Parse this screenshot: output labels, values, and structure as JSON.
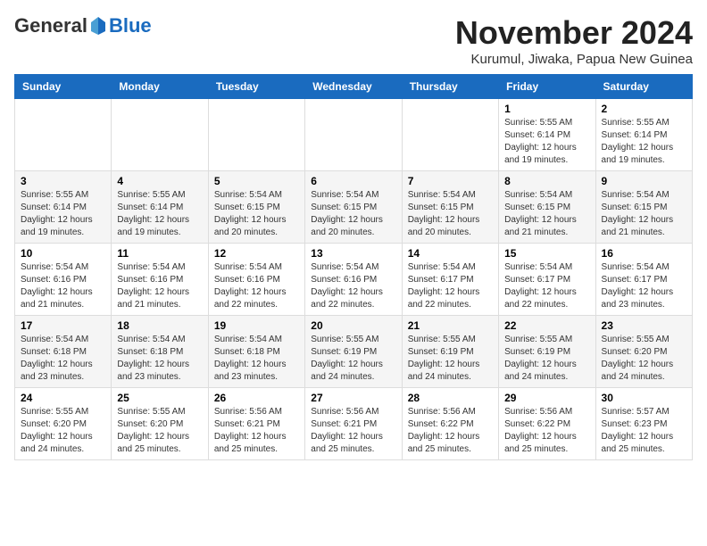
{
  "logo": {
    "general": "General",
    "blue": "Blue"
  },
  "title": "November 2024",
  "location": "Kurumul, Jiwaka, Papua New Guinea",
  "days_of_week": [
    "Sunday",
    "Monday",
    "Tuesday",
    "Wednesday",
    "Thursday",
    "Friday",
    "Saturday"
  ],
  "weeks": [
    [
      {
        "day": "",
        "info": ""
      },
      {
        "day": "",
        "info": ""
      },
      {
        "day": "",
        "info": ""
      },
      {
        "day": "",
        "info": ""
      },
      {
        "day": "",
        "info": ""
      },
      {
        "day": "1",
        "info": "Sunrise: 5:55 AM\nSunset: 6:14 PM\nDaylight: 12 hours\nand 19 minutes."
      },
      {
        "day": "2",
        "info": "Sunrise: 5:55 AM\nSunset: 6:14 PM\nDaylight: 12 hours\nand 19 minutes."
      }
    ],
    [
      {
        "day": "3",
        "info": "Sunrise: 5:55 AM\nSunset: 6:14 PM\nDaylight: 12 hours\nand 19 minutes."
      },
      {
        "day": "4",
        "info": "Sunrise: 5:55 AM\nSunset: 6:14 PM\nDaylight: 12 hours\nand 19 minutes."
      },
      {
        "day": "5",
        "info": "Sunrise: 5:54 AM\nSunset: 6:15 PM\nDaylight: 12 hours\nand 20 minutes."
      },
      {
        "day": "6",
        "info": "Sunrise: 5:54 AM\nSunset: 6:15 PM\nDaylight: 12 hours\nand 20 minutes."
      },
      {
        "day": "7",
        "info": "Sunrise: 5:54 AM\nSunset: 6:15 PM\nDaylight: 12 hours\nand 20 minutes."
      },
      {
        "day": "8",
        "info": "Sunrise: 5:54 AM\nSunset: 6:15 PM\nDaylight: 12 hours\nand 21 minutes."
      },
      {
        "day": "9",
        "info": "Sunrise: 5:54 AM\nSunset: 6:15 PM\nDaylight: 12 hours\nand 21 minutes."
      }
    ],
    [
      {
        "day": "10",
        "info": "Sunrise: 5:54 AM\nSunset: 6:16 PM\nDaylight: 12 hours\nand 21 minutes."
      },
      {
        "day": "11",
        "info": "Sunrise: 5:54 AM\nSunset: 6:16 PM\nDaylight: 12 hours\nand 21 minutes."
      },
      {
        "day": "12",
        "info": "Sunrise: 5:54 AM\nSunset: 6:16 PM\nDaylight: 12 hours\nand 22 minutes."
      },
      {
        "day": "13",
        "info": "Sunrise: 5:54 AM\nSunset: 6:16 PM\nDaylight: 12 hours\nand 22 minutes."
      },
      {
        "day": "14",
        "info": "Sunrise: 5:54 AM\nSunset: 6:17 PM\nDaylight: 12 hours\nand 22 minutes."
      },
      {
        "day": "15",
        "info": "Sunrise: 5:54 AM\nSunset: 6:17 PM\nDaylight: 12 hours\nand 22 minutes."
      },
      {
        "day": "16",
        "info": "Sunrise: 5:54 AM\nSunset: 6:17 PM\nDaylight: 12 hours\nand 23 minutes."
      }
    ],
    [
      {
        "day": "17",
        "info": "Sunrise: 5:54 AM\nSunset: 6:18 PM\nDaylight: 12 hours\nand 23 minutes."
      },
      {
        "day": "18",
        "info": "Sunrise: 5:54 AM\nSunset: 6:18 PM\nDaylight: 12 hours\nand 23 minutes."
      },
      {
        "day": "19",
        "info": "Sunrise: 5:54 AM\nSunset: 6:18 PM\nDaylight: 12 hours\nand 23 minutes."
      },
      {
        "day": "20",
        "info": "Sunrise: 5:55 AM\nSunset: 6:19 PM\nDaylight: 12 hours\nand 24 minutes."
      },
      {
        "day": "21",
        "info": "Sunrise: 5:55 AM\nSunset: 6:19 PM\nDaylight: 12 hours\nand 24 minutes."
      },
      {
        "day": "22",
        "info": "Sunrise: 5:55 AM\nSunset: 6:19 PM\nDaylight: 12 hours\nand 24 minutes."
      },
      {
        "day": "23",
        "info": "Sunrise: 5:55 AM\nSunset: 6:20 PM\nDaylight: 12 hours\nand 24 minutes."
      }
    ],
    [
      {
        "day": "24",
        "info": "Sunrise: 5:55 AM\nSunset: 6:20 PM\nDaylight: 12 hours\nand 24 minutes."
      },
      {
        "day": "25",
        "info": "Sunrise: 5:55 AM\nSunset: 6:20 PM\nDaylight: 12 hours\nand 25 minutes."
      },
      {
        "day": "26",
        "info": "Sunrise: 5:56 AM\nSunset: 6:21 PM\nDaylight: 12 hours\nand 25 minutes."
      },
      {
        "day": "27",
        "info": "Sunrise: 5:56 AM\nSunset: 6:21 PM\nDaylight: 12 hours\nand 25 minutes."
      },
      {
        "day": "28",
        "info": "Sunrise: 5:56 AM\nSunset: 6:22 PM\nDaylight: 12 hours\nand 25 minutes."
      },
      {
        "day": "29",
        "info": "Sunrise: 5:56 AM\nSunset: 6:22 PM\nDaylight: 12 hours\nand 25 minutes."
      },
      {
        "day": "30",
        "info": "Sunrise: 5:57 AM\nSunset: 6:23 PM\nDaylight: 12 hours\nand 25 minutes."
      }
    ]
  ]
}
